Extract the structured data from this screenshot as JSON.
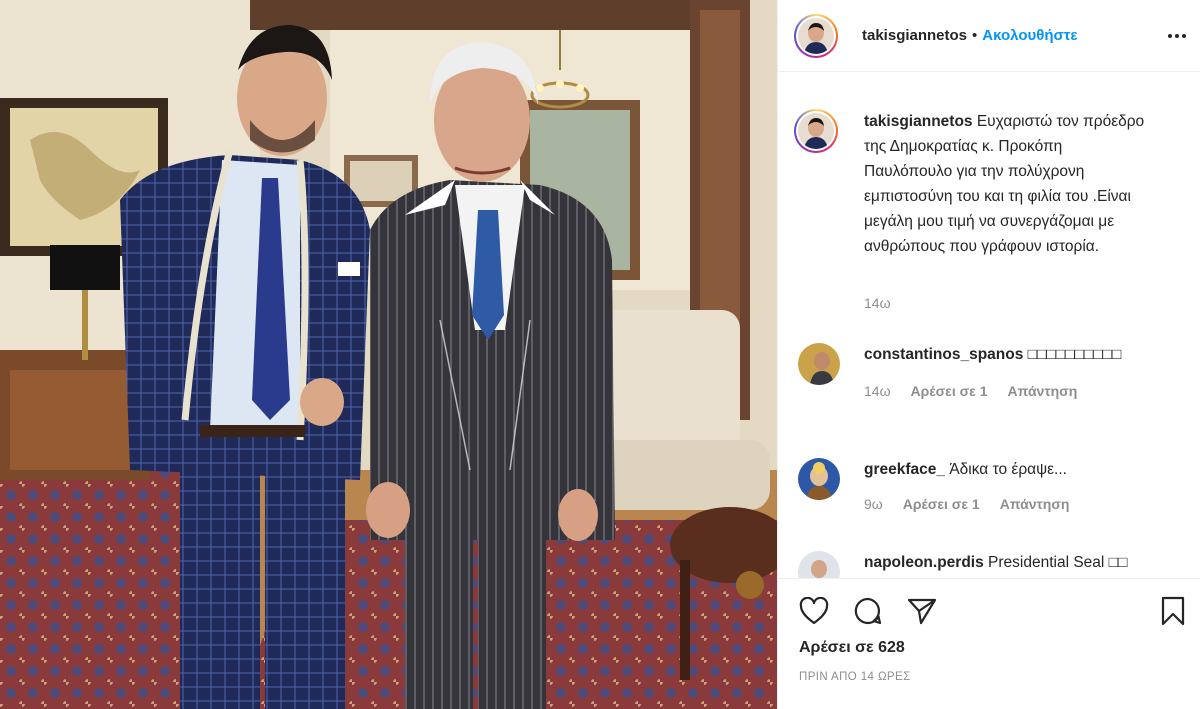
{
  "post": {
    "username": "takisgiannetos",
    "separator": "•",
    "follow_label": "Ακολουθήστε",
    "more_icon": "more-horizontal-icon",
    "caption_username": "takisgiannetos",
    "caption_text": "Ευχαριστώ τον πρόεδρο της Δημοκρατίας κ. Προκόπη Παυλόπουλο για την πολύχρονη εμπιστοσύνη του και τη φιλία του .Είναι μεγάλη μου τιμή να συνεργάζομαι με ανθρώπους που γράφουν ιστορία.",
    "caption_time": "14ω"
  },
  "comments": [
    {
      "username": "constantinos_spanos",
      "text": "□□□□□□□□□□",
      "time": "14ω",
      "likes_label": "Αρέσει σε 1",
      "reply_label": "Απάντηση"
    },
    {
      "username": "greekface_",
      "text": "Άδικα το έραψε...",
      "time": "9ω",
      "likes_label": "Αρέσει σε 1",
      "reply_label": "Απάντηση"
    },
    {
      "username": "napoleon.perdis",
      "text": "Presidential Seal □□"
    }
  ],
  "footer": {
    "like_icon": "heart-icon",
    "comment_icon": "comment-icon",
    "share_icon": "paper-plane-icon",
    "save_icon": "bookmark-icon",
    "likes_count": "Αρέσει σε 628",
    "time_ago": "ΠΡΙΝ ΑΠΟ 14 ΩΡΕΣ"
  },
  "colors": {
    "link_blue": "#0095f6",
    "muted": "#8e8e8e",
    "text": "#262626",
    "border": "#efefef"
  }
}
